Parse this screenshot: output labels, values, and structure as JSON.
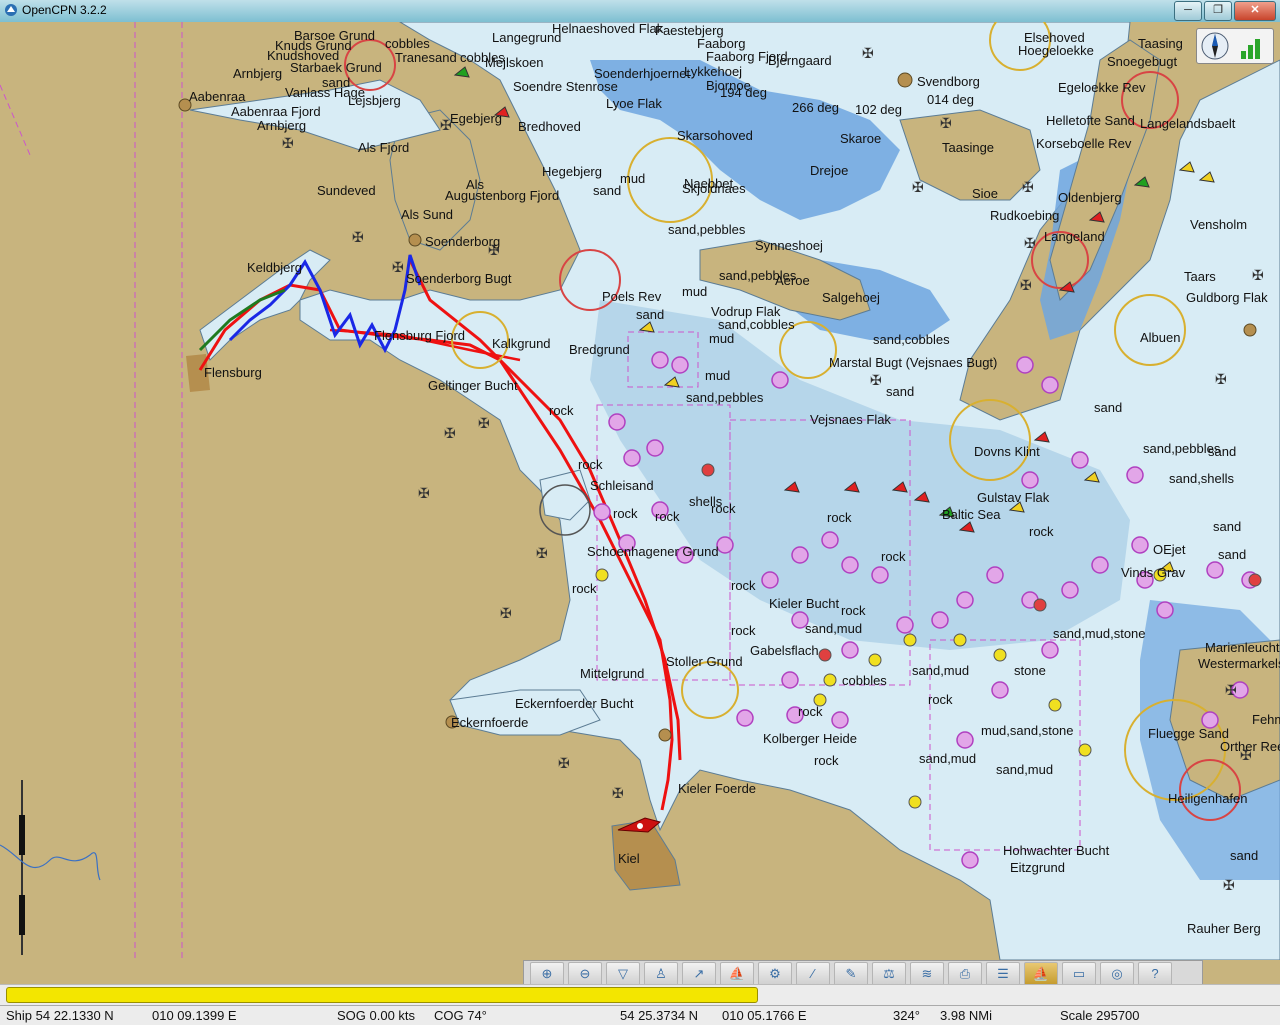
{
  "window": {
    "title": "OpenCPN 3.2.2",
    "minimize_glyph": "─",
    "restore_glyph": "❐",
    "close_glyph": "✕"
  },
  "colors": {
    "land": "#c8b47e",
    "shallow_water": "#6fa6df",
    "deep_water": "#d8ecf5",
    "mid_water": "#b6d6ea",
    "route_red": "#ee1111",
    "track_blue": "#1a28e6",
    "track_green": "#1f7a1f",
    "progress_yellow": "#f3e600"
  },
  "chart": {
    "place_labels": {
      "barsoe_grund": "Barsoe Grund",
      "knuds_grund": "Knuds Grund",
      "cobbles_1": "cobbles",
      "tranesand": "Tranesand",
      "cobbles_2": "cobbles",
      "langegrund": "Langegrund",
      "helnaeshoved_flak": "Helnaeshoved Flak",
      "faestebjerg": "Faestebjerg",
      "elsehoved": "Elsehoved",
      "taasing": "Taasing",
      "knudshoved": "Knudshoved",
      "starbaek_grund": "Starbaek Grund",
      "mejlskoen": "Mejlskoen",
      "faaborg": "Faaborg",
      "faaborg_fjord": "Faaborg Fjord",
      "bjerngaard": "Bjerngaard",
      "hoegeloekke": "Hoegeloekke",
      "arnbjerg": "Arnbjerg",
      "sand_1": "sand",
      "soenderhjoernet": "Soenderhjoernet",
      "lyk_laekke": "Lykkehoej",
      "svendborg": "Svendborg",
      "snoegebugt": "Snoegebugt",
      "aabenraa": "Aabenraa",
      "vanlass_hage": "Vanlass Hage",
      "soendre_stenrose": "Soendre Stenrose",
      "bjornoe": "Bjornoe",
      "egeloekke_rev": "Egeloekke Rev",
      "aabenraa_fjord": "Aabenraa Fjord",
      "lejsbjerg": "Lejsbjerg",
      "lyoe_flak": "Lyoe Flak",
      "deg_266": "266 deg",
      "deg_102": "102 deg",
      "deg_014": "014 deg",
      "deg_194": "194 deg",
      "helletofte_sand": "Helletofte Sand",
      "arnbjerg_2": "Arnbjerg",
      "egebjerg": "Egebjerg",
      "bredhoved": "Bredhoved",
      "skarsohoved": "Skarsohoved",
      "skaroe": "Skaroe",
      "korseboelle_rev": "Korseboelle Rev",
      "langelandsbaelt": "Langelandsbaelt",
      "als_fjord": "Als Fjord",
      "taasinge": "Taasinge",
      "hegebjerg": "Hegebjerg",
      "sand_2": "sand",
      "mud_1": "mud",
      "naebbet": "Naebbet",
      "skjoldnaes": "Skjoldnaes",
      "drejoe": "Drejoe",
      "als": "Als",
      "augustenborg_fjord": "Augustenborg Fjord",
      "sioe": "Sioe",
      "oldenbjerg": "Oldenbjerg",
      "sundeved": "Sundeved",
      "rudkoebing": "Rudkoebing",
      "vensholm": "Vensholm",
      "als_sund": "Als Sund",
      "sand_pebbles_1": "sand,pebbles",
      "langeland": "Langeland",
      "soenderborg": "Soenderborg",
      "synneshoej": "Synneshoej",
      "keldbjerg": "Keldbjerg",
      "soenderborg_bugt": "Soenderborg Bugt",
      "sand_pebbles_2": "sand,pebbles",
      "aeroe": "Aeroe",
      "taars": "Taars",
      "gulstav_flak_top": "Guldborg Flak",
      "vodrup_flak": "Vodrup Flak",
      "poels_rev": "Poels Rev",
      "mud_2": "mud",
      "salgehoej": "Salgehoej",
      "sand_cobbles_1": "sand,cobbles",
      "alboen": "Albuen",
      "flensburg_fjord": "Flensburg Fjord",
      "kalkgrund": "Kalkgrund",
      "bredgrund": "Bredgrund",
      "sand_3": "sand",
      "mud_3": "mud",
      "sand_cobbles_2": "sand,cobbles",
      "marstal_bugt": "Marstal Bugt (Vejsnaes Bugt)",
      "flensburg": "Flensburg",
      "geltinger_bucht": "Geltinger Bucht",
      "mud_4": "mud",
      "sand_4": "sand",
      "sand_pebbles_3": "sand,pebbles",
      "rock_1": "rock",
      "vejsnaes_flak": "Vejsnaes Flak",
      "sand_5": "sand",
      "dovns_klint": "Dovns Klint",
      "sand_6": "sand",
      "sand_pebbles_4": "sand,pebbles",
      "rock_2": "rock",
      "schleisand": "Schleisand",
      "shells": "shells",
      "sand_shells": "sand,shells",
      "rock_3": "rock",
      "rock_4": "rock",
      "rock_5": "rock",
      "gulstav_flak": "Gulstav Flak",
      "baltic_sea": "Baltic Sea",
      "rock_6": "rock",
      "sand_7": "sand",
      "schoenhagener_grund": "Schoenhagener Grund",
      "oejet": "OEjet",
      "sand_8": "sand",
      "rock_7": "rock",
      "rock_8": "rock",
      "vinds_grav": "Vinds Grav",
      "rock_9": "rock",
      "rock_10": "rock",
      "kieler_bucht": "Kieler Bucht",
      "rock_11": "rock",
      "sand_mud_1": "sand,mud",
      "sand_mud_stone": "sand,mud,stone",
      "rock_12": "rock",
      "gabelsflach": "Gabelsflach",
      "stoller_grund": "Stoller Grund",
      "mittelgrund": "Mittelgrund",
      "sand_mud_2": "sand,mud",
      "stone": "stone",
      "cobbles_3": "cobbles",
      "eckernfoerder_bucht": "Eckernfoerder Bucht",
      "rock_13": "rock",
      "eckernfoerde": "Eckernfoerde",
      "rock_14": "rock",
      "kolberger_heide": "Kolberger Heide",
      "mud_sand_stone": "mud,sand,stone",
      "fluegge_sand": "Fluegge Sand",
      "fehmarn": "Fehmarn",
      "rock_15": "rock",
      "sand_mud_3": "sand,mud",
      "sand_mud_4": "sand,mud",
      "kieler_foerde": "Kieler Foerde",
      "heiligenhafen": "Heiligenhafen",
      "hohwachter_bucht": "Hohwachter Bucht",
      "eitzgrund": "Eitzgrund",
      "kiel": "Kiel",
      "rauher_berg": "Rauher Berg",
      "sand_9": "sand",
      "westermarkelsdorf": "Westermarkelsdorf",
      "marienleuchte": "Marienleuchte",
      "orther_reede": "Orther Reede"
    }
  },
  "toolbar": {
    "buttons": [
      {
        "name": "zoom-in",
        "glyph": "⊕"
      },
      {
        "name": "zoom-out",
        "glyph": "⊖"
      },
      {
        "name": "scale-in",
        "glyph": "▽"
      },
      {
        "name": "scale-out",
        "glyph": "♙"
      },
      {
        "name": "route",
        "glyph": "↗"
      },
      {
        "name": "auto-follow",
        "glyph": "⛵"
      },
      {
        "name": "settings",
        "glyph": "⚙"
      },
      {
        "name": "text",
        "glyph": "∕"
      },
      {
        "name": "current-tide",
        "glyph": "✎"
      },
      {
        "name": "tides",
        "glyph": "⚖"
      },
      {
        "name": "chart-quilting",
        "glyph": "≋"
      },
      {
        "name": "print",
        "glyph": "⎙"
      },
      {
        "name": "route-manager",
        "glyph": "☰"
      },
      {
        "name": "track",
        "glyph": "⛵"
      },
      {
        "name": "color-scheme",
        "glyph": "▭"
      },
      {
        "name": "mob",
        "glyph": "◎"
      },
      {
        "name": "about",
        "glyph": "?"
      }
    ]
  },
  "progress": {
    "value": 0.595
  },
  "status": {
    "ship": "Ship 54 22.1330 N",
    "ship_lon": "010 09.1399 E",
    "sog": "SOG 0.00 kts",
    "cog": "COG 74°",
    "cursor_lat": "54 25.3734 N",
    "cursor_lon": "010 05.1766 E",
    "bearing": "324°",
    "distance": "3.98 NMi",
    "scale": "Scale 295700"
  }
}
